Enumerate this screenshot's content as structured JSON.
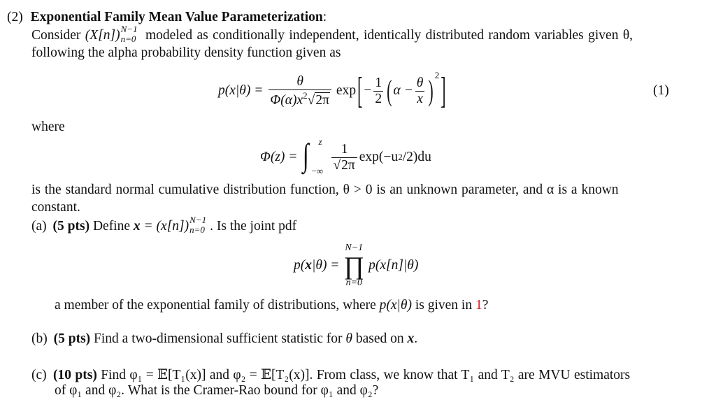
{
  "problem": {
    "number": "(2)",
    "title": "Exponential Family Mean Value Parameterization",
    "title_colon": ":",
    "intro_line1_pre": "Consider ",
    "intro_seq": "(X[n])",
    "intro_seq_sup": "N−1",
    "intro_seq_sub": "n=0",
    "intro_line1_post": " modeled as conditionally independent, identically distributed random variables given θ,",
    "intro_line2": "following the alpha probability density function given as",
    "eq1": {
      "lhs": "p(x|θ) =",
      "frac_num": "θ",
      "frac_den_a": "Φ(α)x",
      "frac_den_sup": "2",
      "frac_den_sqrt": "2π",
      "exp": "exp",
      "bracket_inner_neg": "−",
      "half_num": "1",
      "half_den": "2",
      "alpha": "α −",
      "inner_num": "θ",
      "inner_den": "x",
      "power": "2",
      "label": "(1)"
    },
    "where_label": "where",
    "eq2": {
      "lhs": "Φ(z) =",
      "upper": "z",
      "lower": "−∞",
      "frac_num": "1",
      "frac_den_sqrt": "2π",
      "tail_pre": "exp(−u",
      "tail_sup": "2",
      "tail_post": "/2)du"
    },
    "after_line1": "is the standard normal cumulative distribution function, θ > 0 is an unknown parameter, and α is a known",
    "after_line2": "constant.",
    "parts": {
      "a": {
        "label": "(a)",
        "points": "(5 pts)",
        "text_pre": " Define ",
        "bold_x": "x",
        "text_eq": " = (x[n])",
        "seq_sup": "N−1",
        "seq_sub": "n=0",
        "text_post": ". Is the joint pdf",
        "eq": {
          "lhs_pre": "p(",
          "lhs_x": "x",
          "lhs_post": "|θ) =",
          "prod_upper": "N−1",
          "prod_symbol": "∏",
          "prod_lower": "n=0",
          "rhs": "p(x[n]|θ)"
        },
        "follow_pre": "a member of the exponential family of distributions, where ",
        "follow_math": "p(x|θ)",
        "follow_mid": " is given in ",
        "follow_ref": "1",
        "follow_post": "?"
      },
      "b": {
        "label": "(b)",
        "points": "(5 pts)",
        "text_pre": " Find a two-dimensional sufficient statistic for ",
        "theta": "θ",
        "text_mid": " based on ",
        "bold_x": "x",
        "text_post": "."
      },
      "c": {
        "label": "(c)",
        "points": "(10 pts)",
        "line1": " Find φ₁ = 𝔼[T₁(x)] and φ₂ = 𝔼[T₂(x)]. From class, we know that T₁ and T₂ are MVU estimators",
        "line2": "of φ₁ and φ₂. What is the Cramer-Rao bound for φ₁ and φ₂?"
      }
    },
    "colors": {
      "text": "#111111",
      "reference_link": "#e8141e",
      "background": "#ffffff"
    }
  }
}
